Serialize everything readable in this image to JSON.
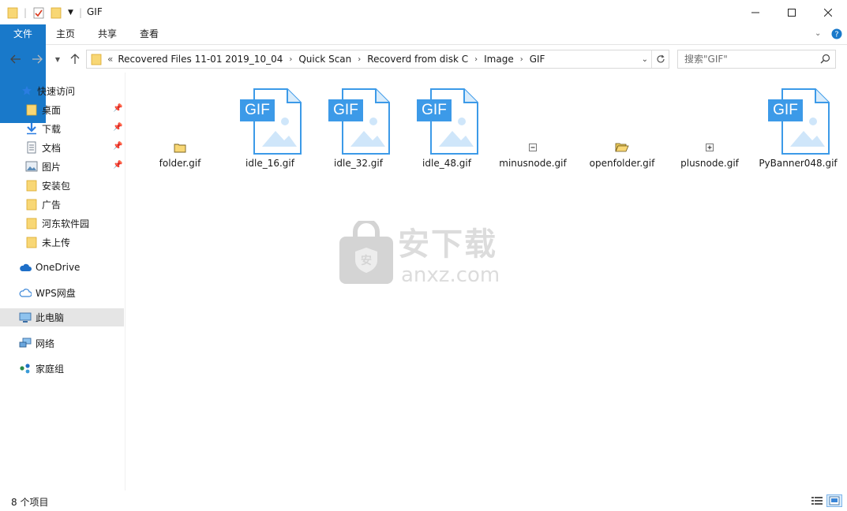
{
  "window": {
    "title": "GIF",
    "minimize_label": "—",
    "maximize_label": "☐",
    "close_label": "✕"
  },
  "ribbon": {
    "tabs": [
      {
        "label": "文件"
      },
      {
        "label": "主页"
      },
      {
        "label": "共享"
      },
      {
        "label": "查看"
      }
    ]
  },
  "address": {
    "overflow": "«",
    "crumbs": [
      "Recovered Files 11-01 2019_10_04",
      "Quick Scan",
      "Recoverd from disk C",
      "Image",
      "GIF"
    ]
  },
  "search": {
    "placeholder": "搜索\"GIF\""
  },
  "sidebar": {
    "items": [
      {
        "label": "快速访问",
        "icon": "star-icon"
      },
      {
        "label": "桌面",
        "icon": "folder-icon",
        "pinned": true
      },
      {
        "label": "下载",
        "icon": "download-icon",
        "pinned": true
      },
      {
        "label": "文档",
        "icon": "document-icon",
        "pinned": true
      },
      {
        "label": "图片",
        "icon": "picture-icon",
        "pinned": true
      },
      {
        "label": "安装包",
        "icon": "folder-icon"
      },
      {
        "label": "广告",
        "icon": "folder-icon"
      },
      {
        "label": "河东软件园",
        "icon": "folder-icon"
      },
      {
        "label": "未上传",
        "icon": "folder-icon"
      },
      {
        "label": "OneDrive",
        "icon": "cloud-icon"
      },
      {
        "label": "WPS网盘",
        "icon": "cloud-outline-icon"
      },
      {
        "label": "此电脑",
        "icon": "computer-icon",
        "selected": true
      },
      {
        "label": "网络",
        "icon": "network-icon"
      },
      {
        "label": "家庭组",
        "icon": "homegroup-icon"
      }
    ]
  },
  "files": [
    {
      "name": "folder.gif",
      "icon": "small-folder-icon"
    },
    {
      "name": "idle_16.gif",
      "icon": "gif-file-icon",
      "badge": "GIF"
    },
    {
      "name": "idle_32.gif",
      "icon": "gif-file-icon",
      "badge": "GIF"
    },
    {
      "name": "idle_48.gif",
      "icon": "gif-file-icon",
      "badge": "GIF"
    },
    {
      "name": "minusnode.gif",
      "icon": "minus-node-icon"
    },
    {
      "name": "openfolder.gif",
      "icon": "open-folder-icon"
    },
    {
      "name": "plusnode.gif",
      "icon": "plus-node-icon"
    },
    {
      "name": "PyBanner048.gif",
      "icon": "gif-file-icon",
      "badge": "GIF"
    }
  ],
  "watermark": {
    "brand": "安下载",
    "domain": "anxz.com"
  },
  "status": {
    "item_count": "8 个项目"
  },
  "colors": {
    "accent": "#1979ca",
    "gif_badge": "#3c9ae8",
    "folder": "#f8d775",
    "selected_row": "#e5e5e5"
  }
}
